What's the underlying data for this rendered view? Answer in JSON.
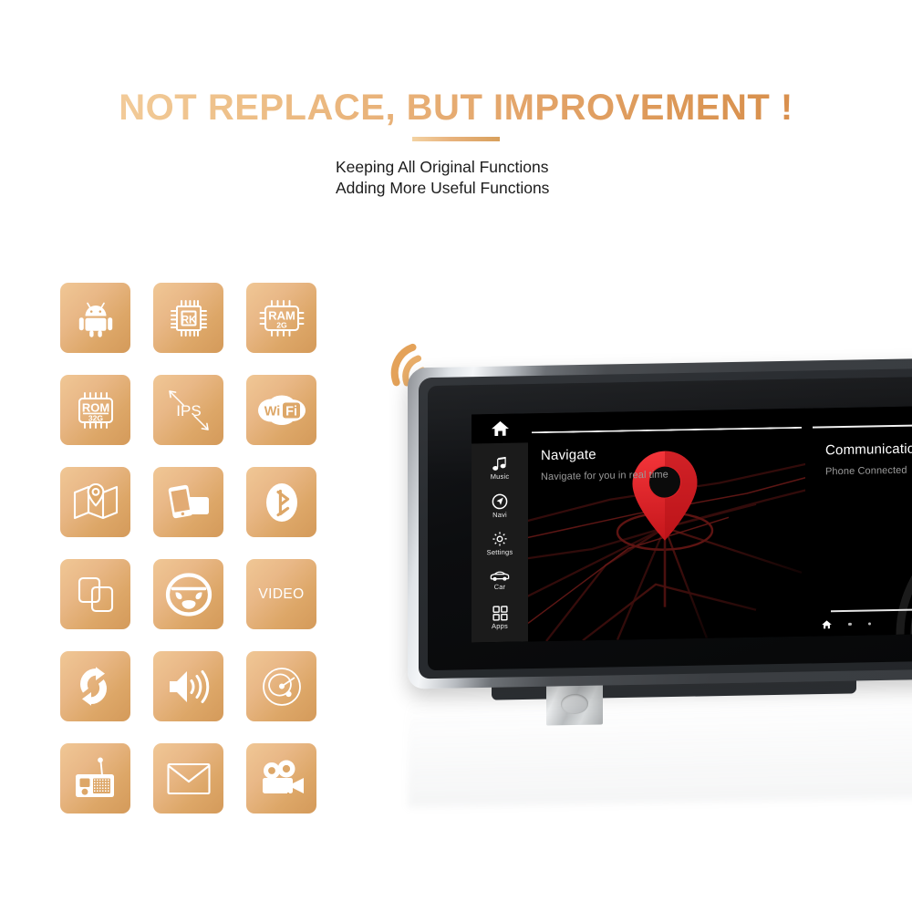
{
  "header": {
    "headline": "NOT REPLACE, BUT IMPROVEMENT !",
    "subtitle_line1": "Keeping All Original Functions",
    "subtitle_line2": "Adding More Useful Functions",
    "accent_color": "#e3a469",
    "text_color": "#1c1c1c"
  },
  "feature_grid": {
    "columns": 3,
    "rows": 6,
    "tile_gradient_from": "#f0c795",
    "tile_gradient_to": "#d49a5a",
    "glyph_color": "#ffffff",
    "tiles": [
      {
        "name": "android-icon",
        "label": "Android",
        "text": ""
      },
      {
        "name": "cpu-chip-icon",
        "label": "RK CPU",
        "text": "RK"
      },
      {
        "name": "ram-chip-icon",
        "label": "RAM 2G",
        "text": "RAM",
        "text2": "2G"
      },
      {
        "name": "rom-chip-icon",
        "label": "ROM 32G",
        "text": "ROM",
        "text2": "32G"
      },
      {
        "name": "ips-screen-icon",
        "label": "IPS Screen",
        "text": "IPS"
      },
      {
        "name": "wifi-icon",
        "label": "WiFi",
        "text": "Wi",
        "text2": "Fi"
      },
      {
        "name": "map-gps-icon",
        "label": "GPS Navigation",
        "text": ""
      },
      {
        "name": "phone-mirror-icon",
        "label": "Phone Mirroring",
        "text": ""
      },
      {
        "name": "bluetooth-icon",
        "label": "Bluetooth",
        "text": ""
      },
      {
        "name": "split-screen-icon",
        "label": "Split Screen",
        "text": ""
      },
      {
        "name": "steering-wheel-icon",
        "label": "Steering Control",
        "text": ""
      },
      {
        "name": "video-icon",
        "label": "Video",
        "text": "VIDEO"
      },
      {
        "name": "update-refresh-icon",
        "label": "Online Update",
        "text": ""
      },
      {
        "name": "speaker-sound-icon",
        "label": "Sound Output",
        "text": ""
      },
      {
        "name": "radar-disc-icon",
        "label": "Radar",
        "text": ""
      },
      {
        "name": "radio-icon",
        "label": "Radio",
        "text": ""
      },
      {
        "name": "envelope-icon",
        "label": "Message",
        "text": ""
      },
      {
        "name": "video-camera-icon",
        "label": "Video Camera",
        "text": ""
      }
    ]
  },
  "head_unit": {
    "wifi_badge": "wifi-signal-icon",
    "bezel_color": "#3b3e42",
    "screen_background": "#000000",
    "sidebar": {
      "home_icon": "home-icon",
      "items": [
        {
          "icon": "music-note-icon",
          "label": "Music"
        },
        {
          "icon": "navigation-arrow-icon",
          "label": "Navi"
        },
        {
          "icon": "gear-icon",
          "label": "Settings"
        },
        {
          "icon": "car-icon",
          "label": "Car"
        },
        {
          "icon": "apps-grid-icon",
          "label": "Apps"
        }
      ]
    },
    "cards": [
      {
        "title": "Navigate",
        "subtitle": "Navigate for you in real time",
        "art": "map-pin"
      },
      {
        "title": "Communication",
        "subtitle": "Phone Connected",
        "art": "signal-arcs"
      }
    ],
    "status_bar": {
      "home_icon": "home-icon",
      "page_dots": 2
    },
    "accent_marker_color": "#e8232a"
  }
}
